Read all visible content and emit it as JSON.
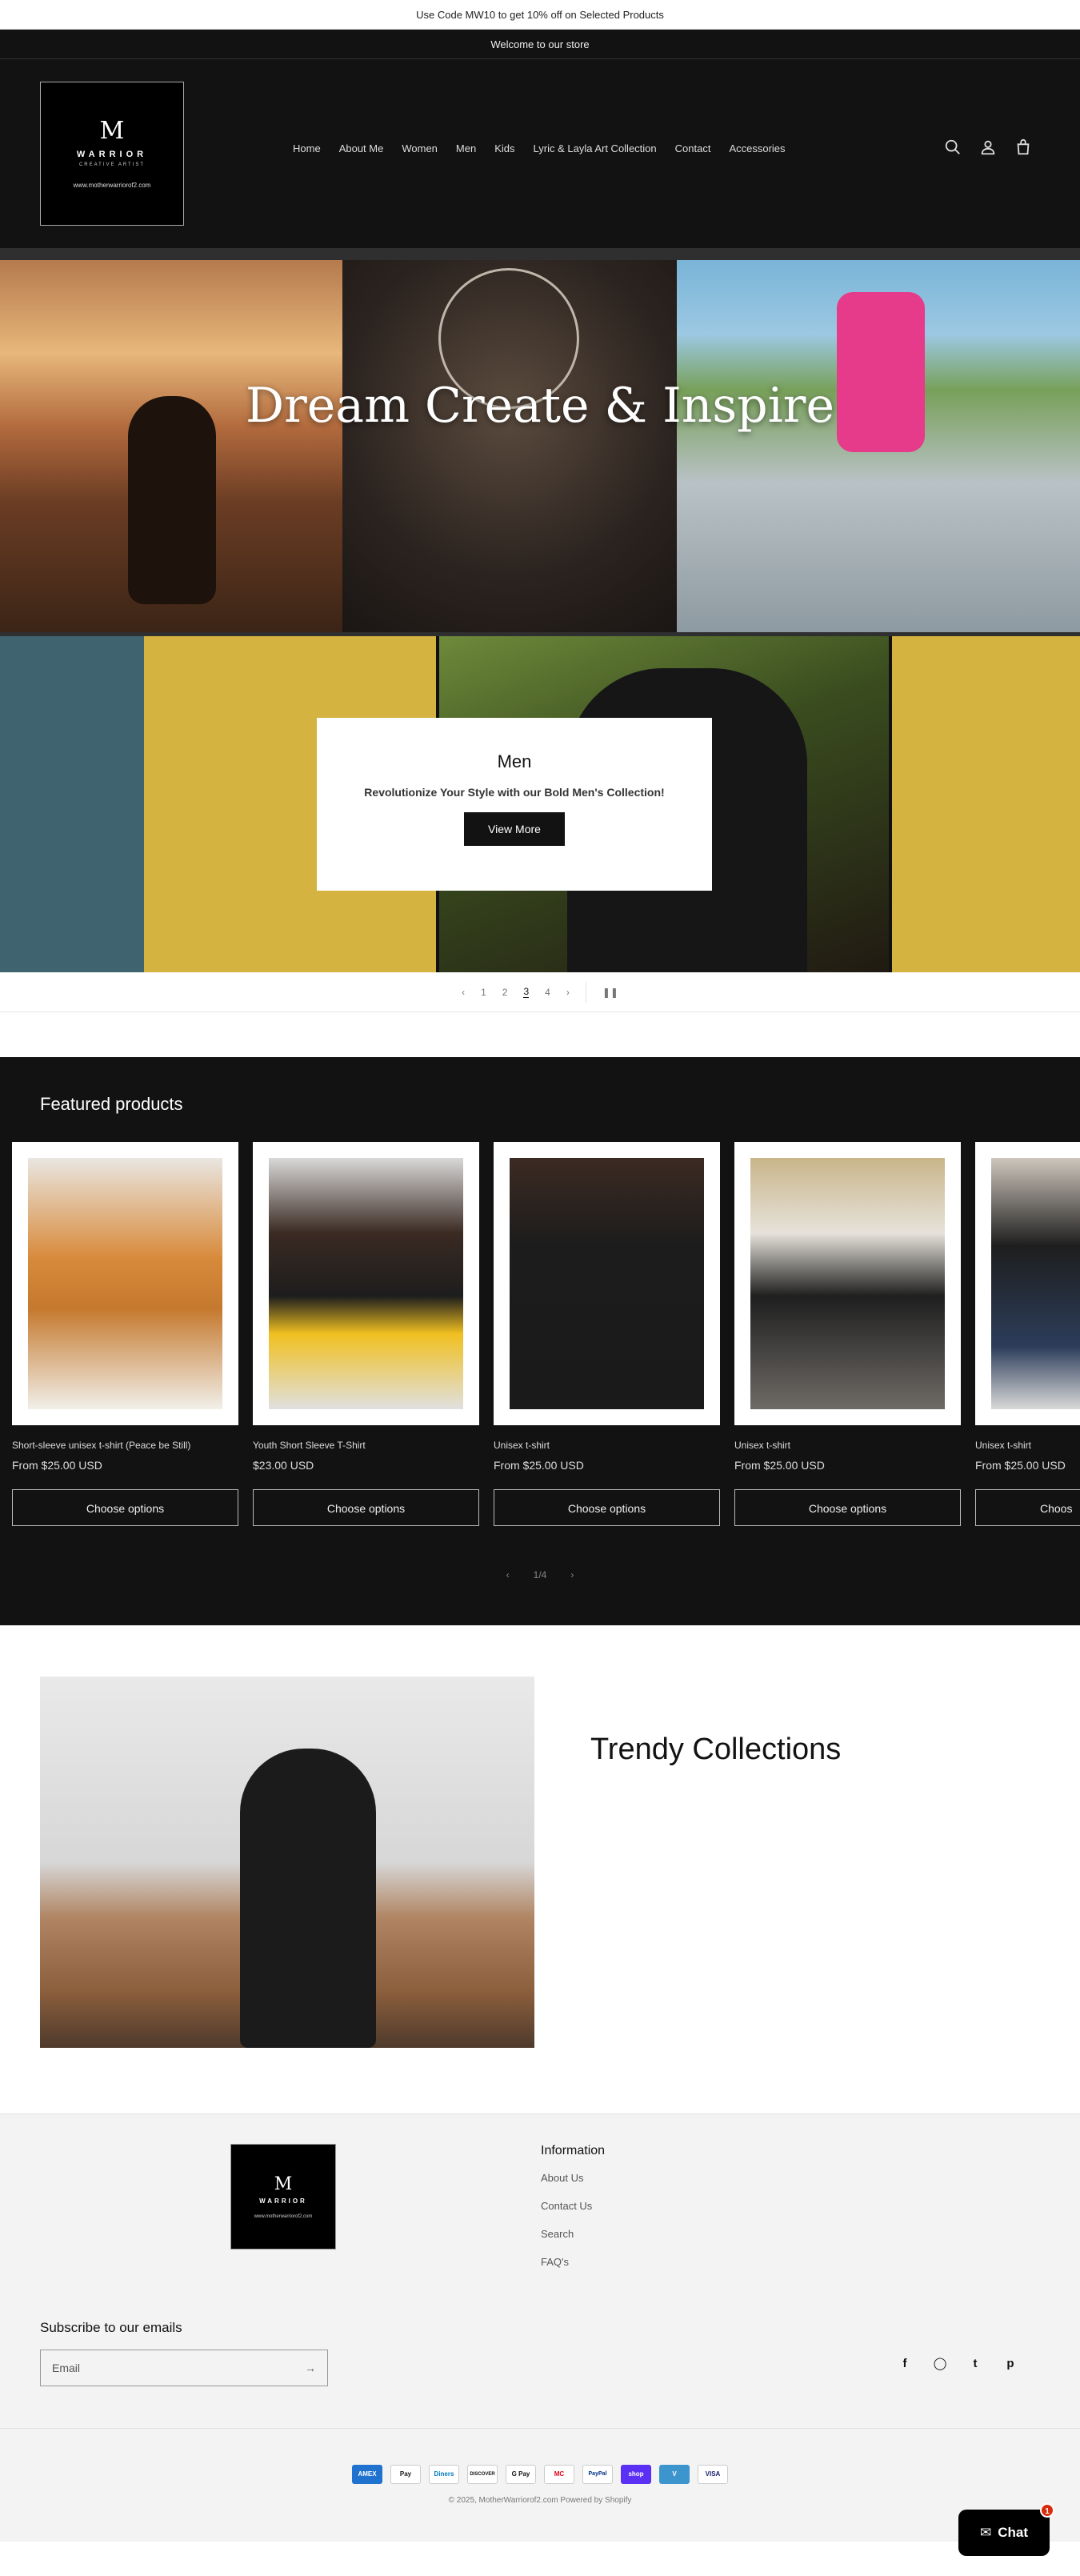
{
  "announcement": {
    "promo": "Use Code MW10 to get 10% off on Selected Products",
    "welcome": "Welcome to our store"
  },
  "header": {
    "logo": {
      "name": "WARRIOR",
      "tagline": "CREATIVE ARTIST",
      "url": "www.motherwarriorof2.com"
    },
    "nav": [
      "Home",
      "About Me",
      "Women",
      "Men",
      "Kids",
      "Lyric & Layla Art Collection",
      "Contact",
      "Accessories"
    ],
    "icons": [
      "search-icon",
      "account-icon",
      "cart-icon"
    ]
  },
  "hero": {
    "title": "Dream Create & Inspire"
  },
  "slideshow": {
    "heading": "Men",
    "text": "Revolutionize Your Style with our Bold Men's Collection!",
    "button": "View More",
    "pages": [
      "1",
      "2",
      "3",
      "4"
    ],
    "current": "3"
  },
  "featured": {
    "title": "Featured products",
    "products": [
      {
        "title": "Short-sleeve unisex t-shirt (Peace be Still)",
        "price": "From $25.00 USD",
        "button": "Choose options"
      },
      {
        "title": "Youth Short Sleeve T-Shirt",
        "price": "$23.00 USD",
        "button": "Choose options"
      },
      {
        "title": "Unisex t-shirt",
        "price": "From $25.00 USD",
        "button": "Choose options"
      },
      {
        "title": "Unisex t-shirt",
        "price": "From $25.00 USD",
        "button": "Choose options"
      },
      {
        "title": "Unisex t-shirt",
        "price": "From $25.00 USD",
        "button": "Choos"
      }
    ],
    "pager": "1/4"
  },
  "trendy": {
    "title": "Trendy Collections"
  },
  "footer": {
    "info_title": "Information",
    "links": [
      "About Us",
      "Contact Us",
      "Search",
      "FAQ's"
    ],
    "subscribe_title": "Subscribe to our emails",
    "email_placeholder": "Email",
    "social": [
      "facebook-icon",
      "instagram-icon",
      "twitter-icon",
      "pinterest-icon"
    ],
    "payments": [
      "AMEX",
      "Pay",
      "Diners",
      "DISCOVER",
      "G Pay",
      "MC",
      "PayPal",
      "shop",
      "V",
      "VISA"
    ],
    "copyright": "© 2025, MotherWarriorof2.com Powered by Shopify"
  },
  "chat": {
    "label": "Chat",
    "badge": "1"
  }
}
